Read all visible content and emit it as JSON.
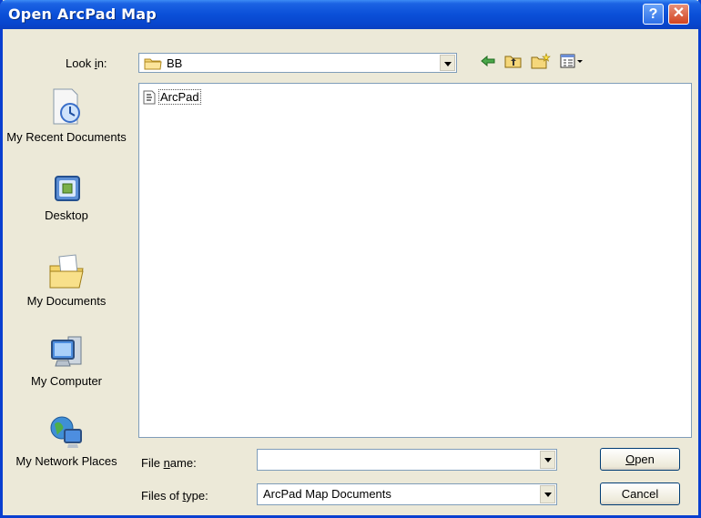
{
  "window": {
    "title": "Open ArcPad Map"
  },
  "titlebar_buttons": {
    "help_label": "?",
    "close_label": "✕"
  },
  "lookin": {
    "label_prefix": "Look ",
    "label_accel": "i",
    "label_suffix": "n:",
    "value": "BB"
  },
  "toolbar": {
    "icons": [
      "back-icon",
      "up-folder-icon",
      "new-folder-icon",
      "view-menu-icon"
    ]
  },
  "places": [
    {
      "label": "My Recent Documents",
      "icon": "recent-documents-icon"
    },
    {
      "label": "Desktop",
      "icon": "desktop-icon"
    },
    {
      "label": "My Documents",
      "icon": "my-documents-icon"
    },
    {
      "label": "My Computer",
      "icon": "my-computer-icon"
    },
    {
      "label": "My Network Places",
      "icon": "network-places-icon"
    }
  ],
  "files": [
    {
      "name": "ArcPad",
      "icon": "arcpad-file-icon"
    }
  ],
  "filename": {
    "label_prefix": "File ",
    "label_accel": "n",
    "label_suffix": "ame:",
    "value": ""
  },
  "filetype": {
    "label_prefix": "Files of ",
    "label_accel": "t",
    "label_suffix": "ype:",
    "value": "ArcPad Map Documents"
  },
  "buttons": {
    "open_accel": "O",
    "open_rest": "pen",
    "cancel": "Cancel"
  }
}
